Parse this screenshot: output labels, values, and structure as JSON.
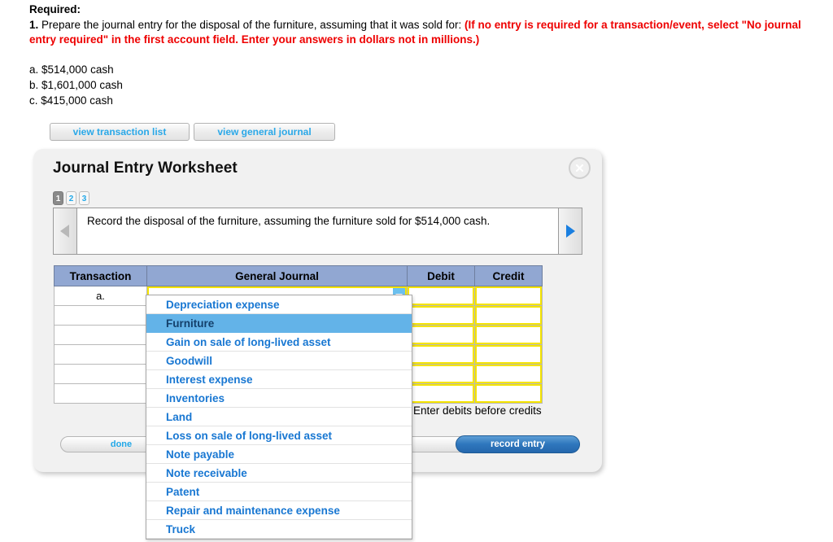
{
  "question": {
    "required_label": "Required:",
    "number": "1.",
    "prompt": " Prepare the journal entry for the disposal of the furniture, assuming that it was sold for: ",
    "red_note": "(If no entry is required for a transaction/event, select \"No journal entry required\" in the first account field. Enter your answers in dollars not in millions.)",
    "options": [
      "a. $514,000 cash",
      "b. $1,601,000 cash",
      "c. $415,000 cash"
    ]
  },
  "view_buttons": [
    {
      "label": "view transaction list"
    },
    {
      "label": "view general journal"
    }
  ],
  "panel": {
    "title": "Journal Entry Worksheet",
    "close_icon": "close-x-icon",
    "steps": [
      {
        "label": "1",
        "active": true
      },
      {
        "label": "2",
        "active": false
      },
      {
        "label": "3",
        "active": false
      }
    ],
    "nav": {
      "prev_icon": "triangle-left-icon",
      "next_icon": "triangle-right-icon",
      "question_text": "Record the disposal of the furniture, assuming the furniture sold for $514,000 cash."
    },
    "table": {
      "headers": [
        "Transaction",
        "General Journal",
        "Debit",
        "Credit"
      ],
      "rows": [
        {
          "transaction": "a.",
          "general_journal": "",
          "debit": "",
          "credit": ""
        },
        {
          "transaction": "",
          "general_journal": "",
          "debit": "",
          "credit": ""
        },
        {
          "transaction": "",
          "general_journal": "",
          "debit": "",
          "credit": ""
        },
        {
          "transaction": "",
          "general_journal": "",
          "debit": "",
          "credit": ""
        },
        {
          "transaction": "",
          "general_journal": "",
          "debit": "",
          "credit": ""
        },
        {
          "transaction": "",
          "general_journal": "",
          "debit": "",
          "credit": ""
        }
      ]
    },
    "hint": "Enter debits before credits",
    "buttons": {
      "done": "done",
      "record_entry": "record entry"
    }
  },
  "dropdown": {
    "open": true,
    "selected": "Furniture",
    "items": [
      {
        "label": "Depreciation expense",
        "clipped": true,
        "selected": false
      },
      {
        "label": "Furniture",
        "clipped": false,
        "selected": true
      },
      {
        "label": "Gain on sale of long-lived asset",
        "clipped": false,
        "selected": false
      },
      {
        "label": "Goodwill",
        "clipped": false,
        "selected": false
      },
      {
        "label": "Interest expense",
        "clipped": false,
        "selected": false
      },
      {
        "label": "Inventories",
        "clipped": false,
        "selected": false
      },
      {
        "label": "Land",
        "clipped": false,
        "selected": false
      },
      {
        "label": "Loss on sale of long-lived asset",
        "clipped": false,
        "selected": false
      },
      {
        "label": "Note payable",
        "clipped": false,
        "selected": false
      },
      {
        "label": "Note receivable",
        "clipped": false,
        "selected": false
      },
      {
        "label": "Patent",
        "clipped": false,
        "selected": false
      },
      {
        "label": "Repair and maintenance expense",
        "clipped": false,
        "selected": false
      },
      {
        "label": "Truck",
        "clipped": false,
        "selected": false
      }
    ]
  },
  "colors": {
    "red_note": "#ee0000",
    "link_blue": "#22a8e8",
    "header_blue": "#91a7d2",
    "dropdown_text": "#1877d2",
    "dropdown_highlight": "#63b3e8",
    "field_outline": "#f5e400",
    "record_button": "#2f77bd"
  }
}
